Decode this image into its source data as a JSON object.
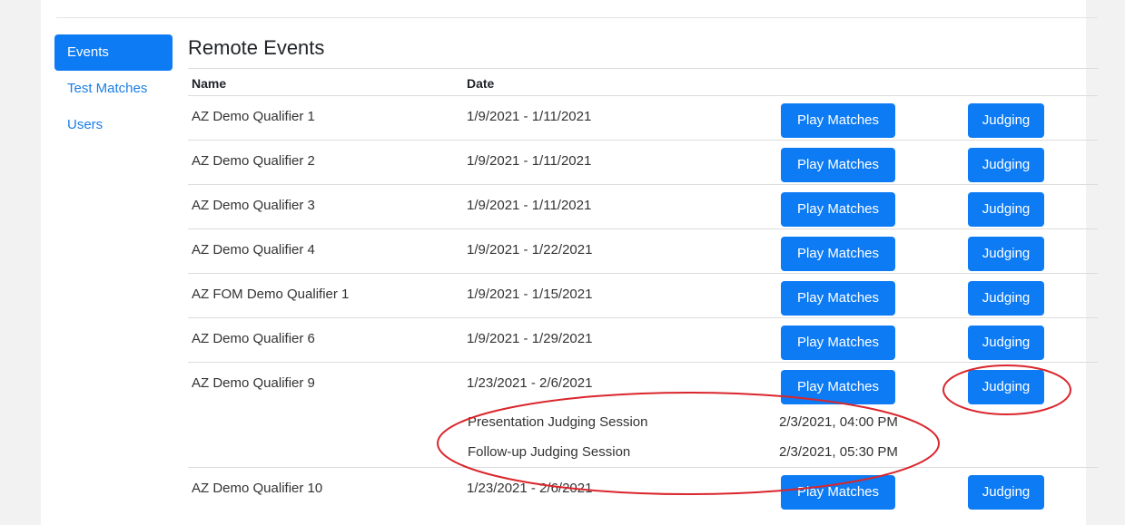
{
  "sidebar": {
    "items": [
      {
        "label": "Events",
        "active": true
      },
      {
        "label": "Test Matches",
        "active": false
      },
      {
        "label": "Users",
        "active": false
      }
    ]
  },
  "main": {
    "title": "Remote Events",
    "columns": {
      "name": "Name",
      "date": "Date"
    },
    "buttons": {
      "play": "Play Matches",
      "judging": "Judging"
    },
    "events": [
      {
        "name": "AZ Demo Qualifier 1",
        "date": "1/9/2021 - 1/11/2021"
      },
      {
        "name": "AZ Demo Qualifier 2",
        "date": "1/9/2021 - 1/11/2021"
      },
      {
        "name": "AZ Demo Qualifier 3",
        "date": "1/9/2021 - 1/11/2021"
      },
      {
        "name": "AZ Demo Qualifier 4",
        "date": "1/9/2021 - 1/22/2021"
      },
      {
        "name": "AZ FOM Demo Qualifier 1",
        "date": "1/9/2021 - 1/15/2021"
      },
      {
        "name": "AZ Demo Qualifier 6",
        "date": "1/9/2021 - 1/29/2021"
      },
      {
        "name": "AZ Demo Qualifier 9",
        "date": "1/23/2021 - 2/6/2021",
        "sessions": [
          {
            "name": "Presentation Judging Session",
            "time": "2/3/2021, 04:00 PM"
          },
          {
            "name": "Follow-up Judging Session",
            "time": "2/3/2021, 05:30 PM"
          }
        ]
      },
      {
        "name": "AZ Demo Qualifier 10",
        "date": "1/23/2021 - 2/6/2021"
      }
    ]
  },
  "annotation": {
    "color": "#d9262c"
  }
}
